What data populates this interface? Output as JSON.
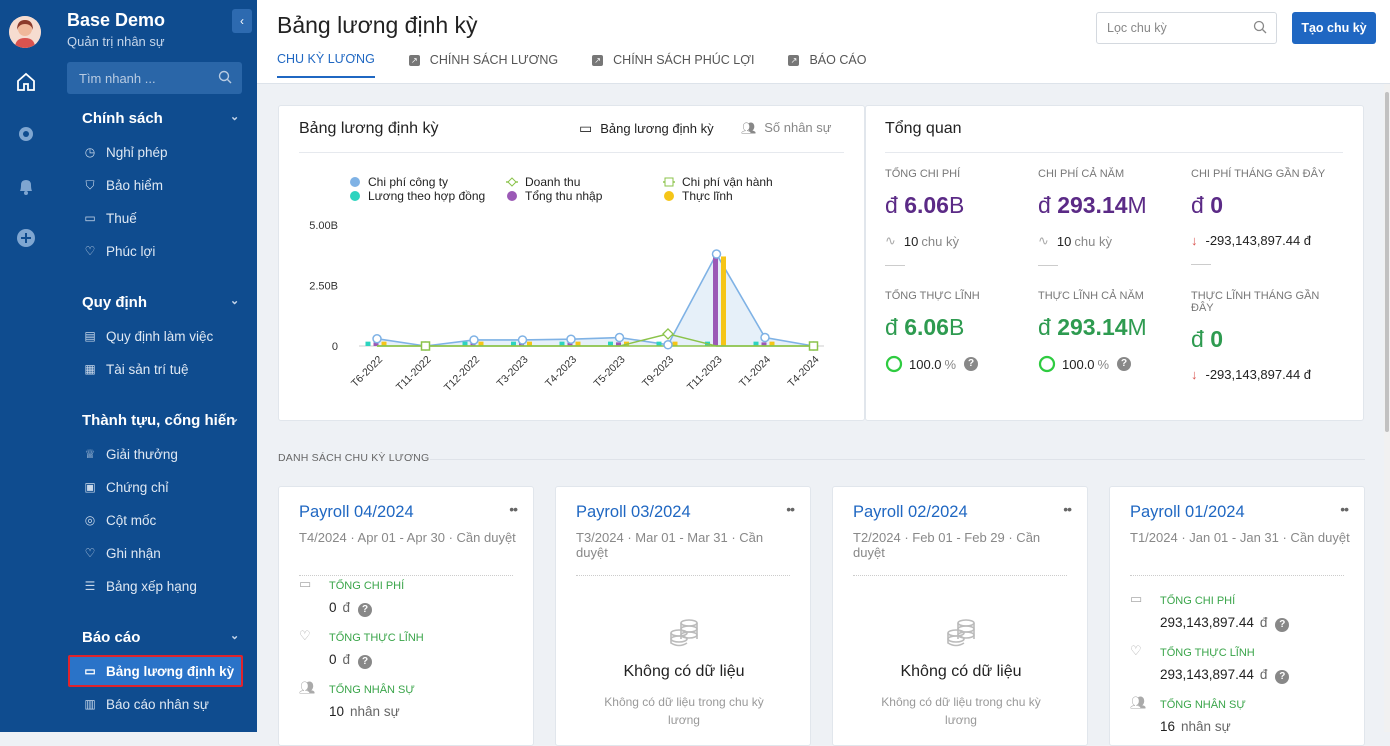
{
  "app": {
    "name": "Base Demo",
    "subtitle": "Quản trị nhân sự",
    "collapse_icon": "chevron-left-icon"
  },
  "rail": {
    "icons": [
      "home-icon",
      "gear-icon",
      "bell-icon",
      "plus-circle-icon"
    ]
  },
  "sidebar": {
    "search_placeholder": "Tìm nhanh ...",
    "groups": [
      {
        "label": "Chính sách",
        "items": [
          {
            "label": "Nghỉ phép",
            "icon": "clock-icon"
          },
          {
            "label": "Bảo hiểm",
            "icon": "shield-icon"
          },
          {
            "label": "Thuế",
            "icon": "folder-icon"
          },
          {
            "label": "Phúc lợi",
            "icon": "heart-icon"
          }
        ]
      },
      {
        "label": "Quy định",
        "items": [
          {
            "label": "Quy định làm việc",
            "icon": "book-icon"
          },
          {
            "label": "Tài sản trí tuệ",
            "icon": "document-icon"
          }
        ]
      },
      {
        "label": "Thành tựu, cống hiến",
        "items": [
          {
            "label": "Giải thưởng",
            "icon": "crown-icon"
          },
          {
            "label": "Chứng chỉ",
            "icon": "certificate-icon"
          },
          {
            "label": "Cột mốc",
            "icon": "target-icon"
          },
          {
            "label": "Ghi nhận",
            "icon": "heart-icon"
          },
          {
            "label": "Bảng xếp hạng",
            "icon": "list-icon"
          }
        ]
      },
      {
        "label": "Báo cáo",
        "items": [
          {
            "label": "Bảng lương định kỳ",
            "icon": "folder-icon",
            "active": true
          },
          {
            "label": "Báo cáo nhân sự",
            "icon": "bar-chart-icon"
          }
        ]
      }
    ]
  },
  "header": {
    "title": "Bảng lương định kỳ",
    "filter_placeholder": "Lọc chu kỳ",
    "create_button": "Tạo chu kỳ",
    "tabs": [
      {
        "label": "CHU KỲ LƯƠNG",
        "active": true
      },
      {
        "label": "CHÍNH SÁCH LƯƠNG"
      },
      {
        "label": "CHÍNH SÁCH PHÚC LỢI"
      },
      {
        "label": "BÁO CÁO"
      }
    ]
  },
  "chart_panel": {
    "title": "Bảng lương định kỳ",
    "switch_a": "Bảng lương định kỳ",
    "switch_b": "Số nhân sự"
  },
  "chart_data": {
    "type": "bar",
    "categories": [
      "T6-2022",
      "T11-2022",
      "T12-2022",
      "T3-2023",
      "T4-2023",
      "T5-2023",
      "T9-2023",
      "T11-2023",
      "T1-2024",
      "T4-2024"
    ],
    "ytick_labels": [
      "5.00B",
      "2.50B",
      "0"
    ],
    "ylim": [
      0,
      5000000000
    ],
    "series": [
      {
        "name": "Chi phí công ty",
        "kind": "area",
        "color": "#7fb2e5",
        "values": [
          300000000.0,
          0,
          250000000.0,
          250000000.0,
          280000000.0,
          350000000.0,
          50000000.0,
          3800000000.0,
          350000000.0,
          0
        ]
      },
      {
        "name": "Lương theo hợp đồng",
        "kind": "bar",
        "color": "#2dd4bf",
        "values": [
          180000000.0,
          0,
          180000000.0,
          180000000.0,
          180000000.0,
          180000000.0,
          180000000.0,
          180000000.0,
          180000000.0,
          0
        ]
      },
      {
        "name": "Doanh thu",
        "kind": "line",
        "color": "#8bc34a",
        "values": [
          0,
          0,
          0,
          0,
          0,
          0,
          500000000.0,
          0,
          0,
          0
        ]
      },
      {
        "name": "Tổng thu nhập",
        "kind": "bar",
        "color": "#9b59b6",
        "values": [
          150000000.0,
          0,
          150000000.0,
          150000000.0,
          150000000.0,
          150000000.0,
          150000000.0,
          3700000000.0,
          150000000.0,
          0
        ]
      },
      {
        "name": "Chi phí vận hành",
        "kind": "line",
        "color": "#8bc34a",
        "values": [
          0,
          0,
          0,
          0,
          0,
          0,
          0,
          0,
          0,
          0
        ]
      },
      {
        "name": "Thực lĩnh",
        "kind": "bar",
        "color": "#f5c518",
        "values": [
          180000000.0,
          0,
          180000000.0,
          180000000.0,
          180000000.0,
          180000000.0,
          180000000.0,
          3700000000.0,
          180000000.0,
          0
        ]
      }
    ],
    "grid": false,
    "legend": "top"
  },
  "overview": {
    "title": "Tổng quan",
    "kpis": [
      {
        "label": "TỔNG CHI PHÍ",
        "currency": "đ",
        "number": "6.06",
        "unit": "B",
        "color": "#5b2a86",
        "foot_icon": "pulse-icon",
        "foot_value": "10",
        "foot_unit": "chu kỳ"
      },
      {
        "label": "CHI PHÍ CẢ NĂM",
        "currency": "đ",
        "number": "293.14",
        "unit": "M",
        "color": "#5b2a86",
        "foot_icon": "pulse-icon",
        "foot_value": "10",
        "foot_unit": "chu kỳ"
      },
      {
        "label": "CHI PHÍ THÁNG GẦN ĐÂY",
        "currency": "đ",
        "number": "0",
        "unit": "",
        "color": "#5b2a86",
        "foot_icon": "arrow-down-icon",
        "foot_value": "-293,143,897.44 đ",
        "foot_unit": ""
      },
      {
        "label": "TỔNG THỰC LĨNH",
        "currency": "đ",
        "number": "6.06",
        "unit": "B",
        "color": "#2e9b50",
        "foot_icon": "progress-ring-icon",
        "foot_value": "100.0",
        "foot_unit": "%",
        "progress": 1.0
      },
      {
        "label": "THỰC LĨNH CẢ NĂM",
        "currency": "đ",
        "number": "293.14",
        "unit": "M",
        "color": "#2e9b50",
        "foot_icon": "progress-ring-icon",
        "foot_value": "100.0",
        "foot_unit": "%",
        "progress": 1.0
      },
      {
        "label": "THỰC LĨNH THÁNG GẦN ĐÂY",
        "currency": "đ",
        "number": "0",
        "unit": "",
        "color": "#2e9b50",
        "foot_icon": "arrow-down-icon",
        "foot_value": "-293,143,897.44 đ",
        "foot_unit": ""
      }
    ]
  },
  "list": {
    "section_title": "DANH SÁCH CHU KỲ LƯƠNG",
    "cards": [
      {
        "title": "Payroll 04/2024",
        "desc": "T4/2024 · Apr 01 - Apr 30 · Cần duyệt",
        "rows": [
          {
            "label": "TỔNG CHI PHÍ",
            "value": "0",
            "unit": "đ"
          },
          {
            "label": "TỔNG THỰC LĨNH",
            "value": "0",
            "unit": "đ"
          },
          {
            "label": "TỔNG NHÂN SỰ",
            "value": "10",
            "unit": "nhân sự"
          }
        ]
      },
      {
        "title": "Payroll 03/2024",
        "desc": "T3/2024 · Mar 01 - Mar 31 · Cần duyệt",
        "empty_title": "Không có dữ liệu",
        "empty_text": "Không có dữ liệu trong chu kỳ lương"
      },
      {
        "title": "Payroll 02/2024",
        "desc": "T2/2024 · Feb 01 - Feb 29 · Cần duyệt",
        "empty_title": "Không có dữ liệu",
        "empty_text": "Không có dữ liệu trong chu kỳ lương"
      },
      {
        "title": "Payroll 01/2024",
        "desc": "T1/2024 · Jan 01 - Jan 31 · Cần duyệt",
        "rows": [
          {
            "label": "TỔNG CHI PHÍ",
            "value": "293,143,897.44",
            "unit": "đ"
          },
          {
            "label": "TỔNG THỰC LĨNH",
            "value": "293,143,897.44",
            "unit": "đ"
          },
          {
            "label": "TỔNG NHÂN SỰ",
            "value": "16",
            "unit": "nhân sự"
          }
        ]
      }
    ]
  }
}
